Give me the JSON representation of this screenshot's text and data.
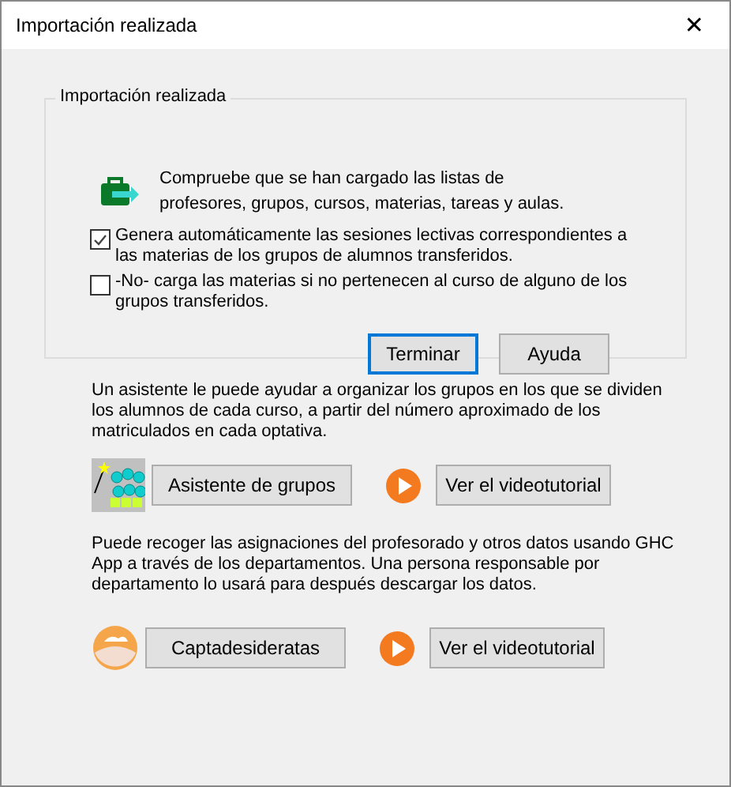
{
  "window": {
    "title": "Importación realizada",
    "close": "✕"
  },
  "group": {
    "title": "Importación realizada",
    "message": "Compruebe que se han cargado las listas de\nprofesores, grupos, cursos, materias, tareas y aulas.",
    "options": [
      {
        "label": "Genera automáticamente las sesiones lectivas correspondientes a las materias de los grupos de alumnos transferidos.",
        "checked": true
      },
      {
        "label": "-No- carga las materias si no pertenecen al curso de alguno de los grupos transferidos.",
        "checked": false
      }
    ],
    "buttons": [
      {
        "label": "Terminar",
        "default": true
      },
      {
        "label": "Ayuda",
        "default": false
      }
    ]
  },
  "sections": [
    {
      "text": "Un asistente le puede ayudar a organizar los grupos en los que se dividen los alumnos de cada curso, a partir del número aproximado de los matriculados en cada optativa.",
      "kind": "groups",
      "button": "Asistente de grupos",
      "video": "Ver el videotutorial"
    },
    {
      "text": "Puede recoger las asignaciones del profesorado y otros datos usando GHC App a través de los departamentos. Una persona responsable por departamento lo usará para después descargar los datos.",
      "kind": "app",
      "button": "Captadesideratas",
      "video": "Ver el videotutorial"
    }
  ]
}
